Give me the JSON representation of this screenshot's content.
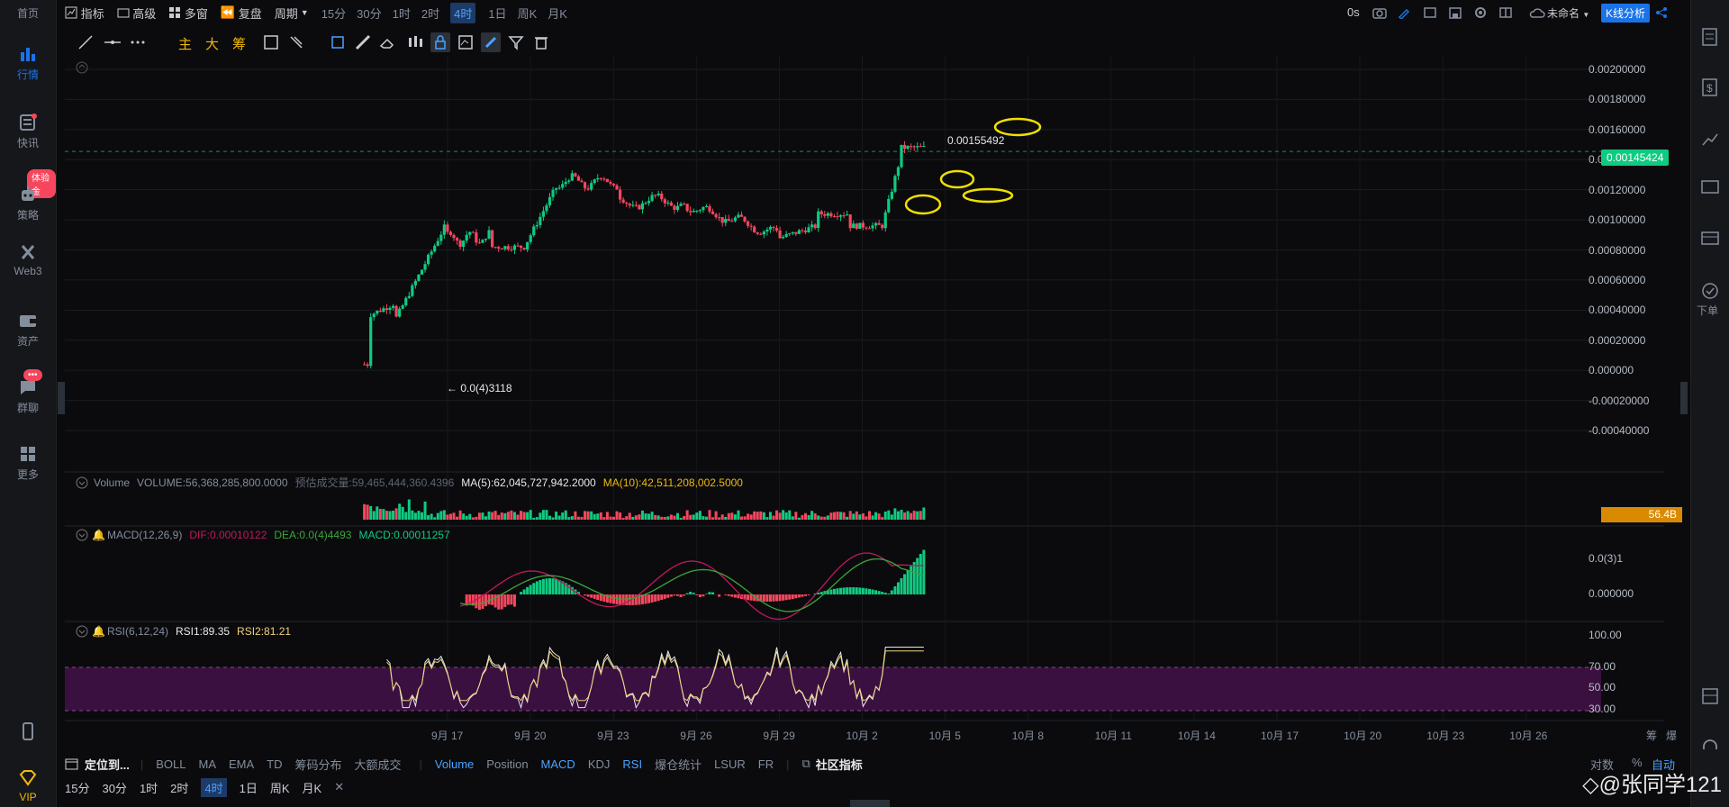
{
  "sidebar": {
    "items": [
      {
        "label": "首页",
        "icon": "home-icon"
      },
      {
        "label": "行情",
        "icon": "chart-bars-icon",
        "active": true
      },
      {
        "label": "快讯",
        "icon": "news-icon"
      },
      {
        "label": "策略",
        "icon": "robot-icon"
      },
      {
        "label": "Web3",
        "icon": "web3-icon"
      },
      {
        "label": "资产",
        "icon": "wallet-icon"
      },
      {
        "label": "群聊",
        "icon": "chat-icon"
      },
      {
        "label": "更多",
        "icon": "grid-icon"
      },
      {
        "label": "",
        "icon": "phone-icon"
      },
      {
        "label": "VIP",
        "icon": "diamond-icon"
      }
    ],
    "badge_strategy": "体验金",
    "badge_chat": "•••"
  },
  "toolbar": {
    "indicator": "指标",
    "advanced": "高级",
    "multi_window": "多窗",
    "replay": "复盘",
    "period": "周期",
    "periods": [
      "15分",
      "30分",
      "1时",
      "2时",
      "4时",
      "1日",
      "周K",
      "月K"
    ],
    "selected_period": "4时",
    "timer": "0s",
    "cloud_name": "未命名",
    "kline_analysis": "K线分析"
  },
  "drawing_tools": {
    "main": "主",
    "big": "大",
    "chips": "筹"
  },
  "price_axis": {
    "labels": [
      "0.00200000",
      "0.00180000",
      "0.00160000",
      "0.00140000",
      "0.00120000",
      "0.00100000",
      "0.00080000",
      "0.00060000",
      "0.00040000",
      "0.00020000",
      "0.000000",
      "-0.00020000",
      "-0.00040000"
    ],
    "current_price": "0.00145424",
    "high_marker": "0.00155492",
    "low_marker": "← 0.0(4)3118"
  },
  "time_axis": {
    "labels": [
      "9月 17",
      "9月 20",
      "9月 23",
      "9月 26",
      "9月 29",
      "10月 2",
      "10月 5",
      "10月 8",
      "10月 11",
      "10月 14",
      "10月 17",
      "10月 20",
      "10月 23",
      "10月 26"
    ]
  },
  "volume_panel": {
    "label": "Volume",
    "volume": "VOLUME:56,368,285,800.0000",
    "estimated": "预估成交量:59,465,444,360.4396",
    "ma5": "MA(5):62,045,727,942.2000",
    "ma10": "MA(10):42,511,208,002.5000",
    "axis_value": "56.4B"
  },
  "macd_panel": {
    "label": "MACD(12,26,9)",
    "dif": "DIF:0.00010122",
    "dea": "DEA:0.0(4)4493",
    "macd": "MACD:0.00011257",
    "axis_top": "0.0(3)1",
    "axis_zero": "0.000000"
  },
  "rsi_panel": {
    "label": "RSI(6,12,24)",
    "rsi1": "RSI1:89.35",
    "rsi2": "RSI2:81.21",
    "axis": [
      "100.00",
      "70.00",
      "50.00",
      "30.00"
    ]
  },
  "bottom_bar": {
    "locate": "定位到...",
    "indicators": [
      "BOLL",
      "MA",
      "EMA",
      "TD",
      "筹码分布",
      "大额成交"
    ],
    "sub_indicators": [
      "Volume",
      "Position",
      "MACD",
      "KDJ",
      "RSI",
      "爆仓统计",
      "LSUR",
      "FR"
    ],
    "active_sub": [
      "Volume",
      "MACD",
      "RSI"
    ],
    "community": "社区指标",
    "log": "对数",
    "percent": "%",
    "auto": "自动",
    "chips_short": "筹",
    "burst_short": "爆"
  },
  "bottom_periods": [
    "15分",
    "30分",
    "1时",
    "2时",
    "4时",
    "1日",
    "周K",
    "月K"
  ],
  "watermark": "◇@张同学121",
  "colors": {
    "up": "#0ecb81",
    "down": "#f6465d",
    "accent": "#1a73e8",
    "yellow": "#f0b90b",
    "rsi_band": "#3a1040"
  }
}
